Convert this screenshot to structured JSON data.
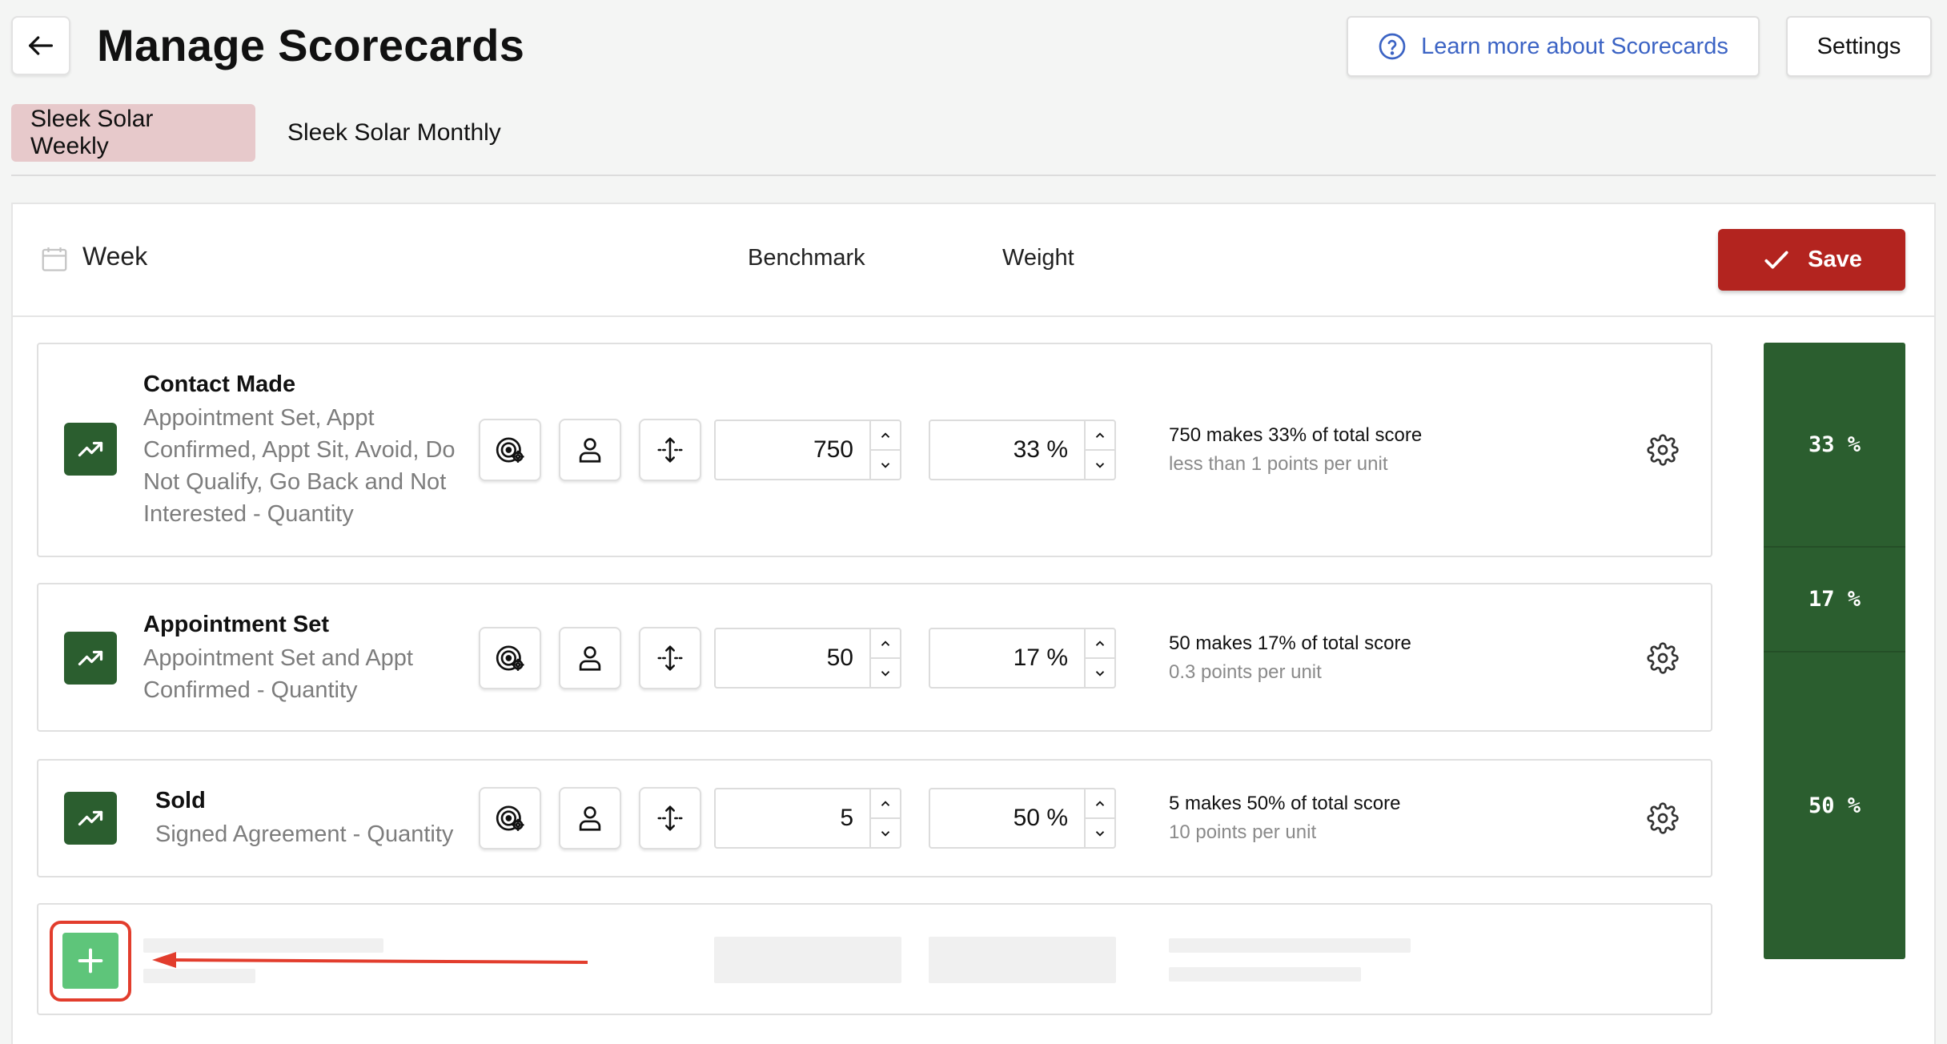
{
  "header": {
    "title": "Manage Scorecards",
    "learn_more_label": "Learn more about Scorecards",
    "settings_label": "Settings"
  },
  "tabs": [
    {
      "label": "Sleek Solar Weekly",
      "active": true
    },
    {
      "label": "Sleek Solar Monthly",
      "active": false
    }
  ],
  "panel": {
    "period_label": "Week",
    "benchmark_header": "Benchmark",
    "weight_header": "Weight",
    "save_label": "Save"
  },
  "rows": [
    {
      "name": "Contact Made",
      "desc_lines": [
        "Appointment Set, Appt",
        "Confirmed, Appt Sit, Avoid, Do",
        "Not Qualify, Go Back and Not",
        "Interested - Quantity"
      ],
      "benchmark": "750",
      "weight": "33 %",
      "summary": "750 makes 33% of total score",
      "points": "less than 1 points per unit"
    },
    {
      "name": "Appointment Set",
      "desc_lines": [
        "Appointment Set and Appt",
        "Confirmed - Quantity"
      ],
      "benchmark": "50",
      "weight": "17 %",
      "summary": "50 makes 17% of total score",
      "points": "0.3 points per unit"
    },
    {
      "name": "Sold",
      "desc_lines": [
        "Signed Agreement - Quantity"
      ],
      "benchmark": "5",
      "weight": "50 %",
      "summary": "5 makes 50% of total score",
      "points": "10 points per unit"
    }
  ],
  "weight_bar": [
    {
      "label": "33 %",
      "value": 33
    },
    {
      "label": "17 %",
      "value": 17
    },
    {
      "label": "50 %",
      "value": 50
    }
  ],
  "colors": {
    "kpi_green": "#2b5e2f",
    "add_green": "#5ec57a",
    "save_red": "#b3241f",
    "active_tab": "#e7c9cb",
    "link_blue": "#3b63c4",
    "highlight_red": "#e23d2d"
  },
  "icons": {
    "back": "arrow-left-icon",
    "help": "question-circle-icon",
    "calendar": "calendar-icon",
    "check": "check-icon",
    "kpi": "trending-up-icon",
    "target": "target-gear-icon",
    "person": "person-icon",
    "move": "move-vertical-icon",
    "gear": "gear-icon",
    "add": "plus-icon"
  }
}
